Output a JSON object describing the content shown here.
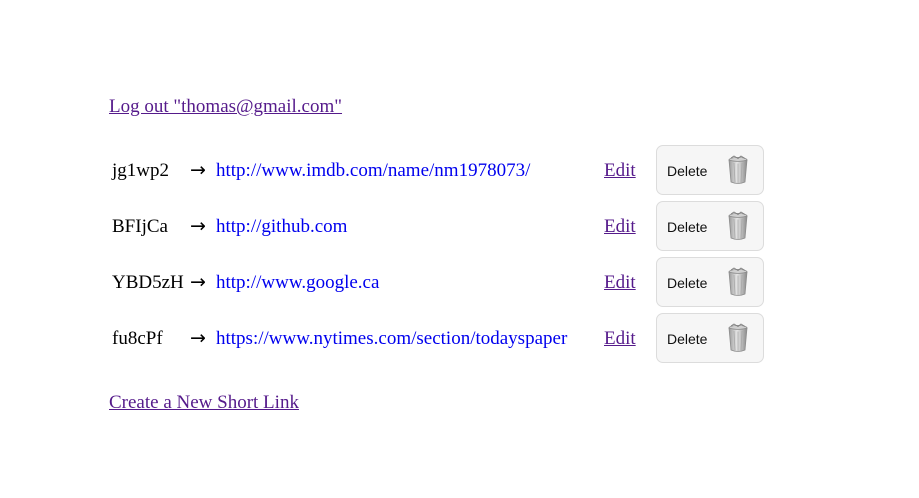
{
  "header": {
    "logout_link": "Log out \"thomas@gmail.com\""
  },
  "links": [
    {
      "code": "jg1wp2",
      "arrow": "→",
      "url": "http://www.imdb.com/name/nm1978073/",
      "edit_label": "Edit",
      "delete_label": "Delete"
    },
    {
      "code": "BFIjCa",
      "arrow": "→",
      "url": "http://github.com",
      "edit_label": "Edit",
      "delete_label": "Delete"
    },
    {
      "code": "YBD5zH",
      "arrow": "→",
      "url": "http://www.google.ca",
      "edit_label": "Edit",
      "delete_label": "Delete"
    },
    {
      "code": "fu8cPf",
      "arrow": "→",
      "url": "https://www.nytimes.com/section/todayspaper",
      "edit_label": "Edit",
      "delete_label": "Delete"
    }
  ],
  "footer": {
    "create_link": "Create a New Short Link"
  },
  "icons": {
    "delete": "trash-can-icon"
  },
  "colors": {
    "visited_link": "#551a8b",
    "url_link": "#0000ee",
    "button_bg": "#f6f6f6",
    "button_border": "#dcdcdc"
  }
}
